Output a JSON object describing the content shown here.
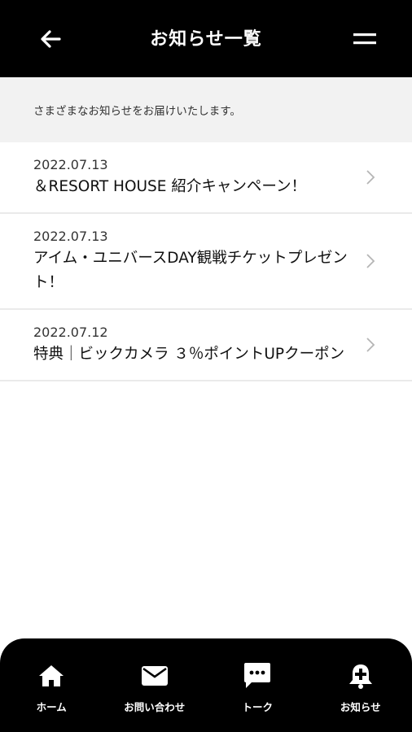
{
  "header": {
    "title": "お知らせ一覧"
  },
  "intro": {
    "text": "さまざまなお知らせをお届けいたします。"
  },
  "notices": [
    {
      "date": "2022.07.13",
      "title": "＆RESORT HOUSE 紹介キャンペーン！"
    },
    {
      "date": "2022.07.13",
      "title": "アイム・ユニバースDAY観戦チケットプレゼント！"
    },
    {
      "date": "2022.07.12",
      "title": "特典｜ビックカメラ ３％ポイントUPクーポン"
    }
  ],
  "bottom_nav": {
    "items": [
      {
        "label": "ホーム",
        "icon": "home-icon"
      },
      {
        "label": "お問い合わせ",
        "icon": "mail-icon"
      },
      {
        "label": "トーク",
        "icon": "chat-icon"
      },
      {
        "label": "お知らせ",
        "icon": "bell-icon"
      }
    ]
  },
  "colors": {
    "header_bg": "#000000",
    "intro_bg": "#f2f2f2",
    "divider": "#eaeaea",
    "nav_bg": "#000000"
  }
}
